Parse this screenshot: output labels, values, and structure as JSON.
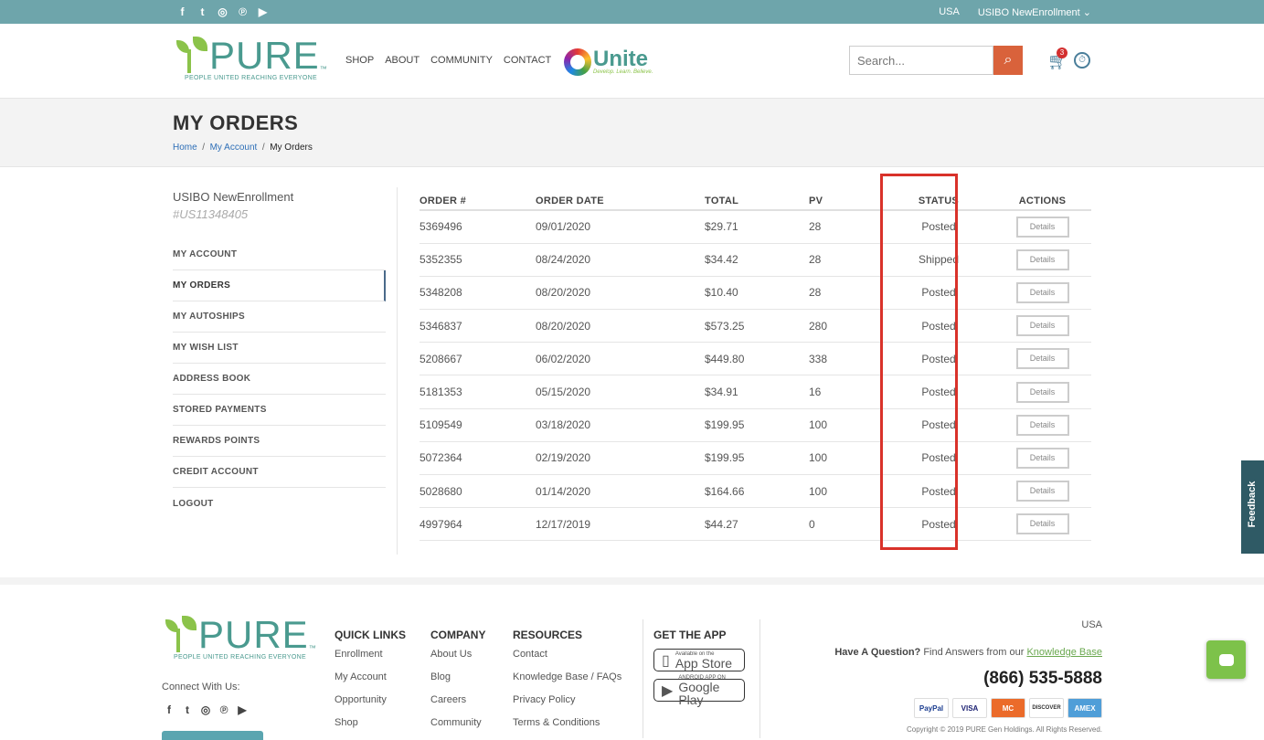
{
  "topbar": {
    "social_icons": [
      "facebook-icon",
      "twitter-icon",
      "instagram-icon",
      "pinterest-icon",
      "youtube-icon"
    ],
    "social_glyphs": [
      "f",
      "t",
      "◎",
      "℗",
      "▶"
    ],
    "country": "USA",
    "account": "USIBO NewEnrollment ⌄"
  },
  "header": {
    "logo_word": "PURE",
    "logo_tm": "™",
    "logo_tagline": "PEOPLE UNITED REACHING EVERYONE",
    "nav": [
      "SHOP",
      "ABOUT",
      "COMMUNITY",
      "CONTACT"
    ],
    "unite_word": "Unite",
    "unite_tagline": "Develop. Learn. Believe.",
    "search_placeholder": "Search...",
    "cart_count": "3"
  },
  "page": {
    "title": "MY ORDERS",
    "breadcrumb": [
      "Home",
      "My Account",
      "My Orders"
    ],
    "breadcrumb_sep": "/"
  },
  "sidebar": {
    "username": "USIBO NewEnrollment",
    "user_id": "#US11348405",
    "items": [
      "MY ACCOUNT",
      "MY ORDERS",
      "MY AUTOSHIPS",
      "MY WISH LIST",
      "ADDRESS BOOK",
      "STORED PAYMENTS",
      "REWARDS POINTS",
      "CREDIT ACCOUNT",
      "LOGOUT"
    ],
    "active_index": 1
  },
  "orders": {
    "columns": [
      "ORDER #",
      "ORDER DATE",
      "TOTAL",
      "PV",
      "STATUS",
      "ACTIONS"
    ],
    "action_label": "Details",
    "rows": [
      [
        "5369496",
        "09/01/2020",
        "$29.71",
        "28",
        "Posted"
      ],
      [
        "5352355",
        "08/24/2020",
        "$34.42",
        "28",
        "Shipped"
      ],
      [
        "5348208",
        "08/20/2020",
        "$10.40",
        "28",
        "Posted"
      ],
      [
        "5346837",
        "08/20/2020",
        "$573.25",
        "280",
        "Posted"
      ],
      [
        "5208667",
        "06/02/2020",
        "$449.80",
        "338",
        "Posted"
      ],
      [
        "5181353",
        "05/15/2020",
        "$34.91",
        "16",
        "Posted"
      ],
      [
        "5109549",
        "03/18/2020",
        "$199.95",
        "100",
        "Posted"
      ],
      [
        "5072364",
        "02/19/2020",
        "$199.95",
        "100",
        "Posted"
      ],
      [
        "5028680",
        "01/14/2020",
        "$164.66",
        "100",
        "Posted"
      ],
      [
        "4997964",
        "12/17/2019",
        "$44.27",
        "0",
        "Posted"
      ]
    ]
  },
  "feedback_label": "Feedback",
  "footer": {
    "connect_label": "Connect With Us:",
    "quick_links": {
      "title": "QUICK LINKS",
      "items": [
        "Enrollment",
        "My Account",
        "Opportunity",
        "Shop"
      ]
    },
    "company": {
      "title": "COMPANY",
      "items": [
        "About Us",
        "Blog",
        "Careers",
        "Community"
      ]
    },
    "resources": {
      "title": "RESOURCES",
      "items": [
        "Contact",
        "Knowledge Base / FAQs",
        "Privacy Policy",
        "Terms & Conditions"
      ]
    },
    "app": {
      "title": "GET THE APP",
      "appstore_small": "Available on the",
      "appstore_big": "App Store",
      "google_small": "ANDROID APP ON",
      "google_big": "Google Play"
    },
    "country": "USA",
    "question_bold": "Have A Question?",
    "question_text": " Find Answers from our ",
    "question_link": "Knowledge Base",
    "phone": "(866) 535-5888",
    "cards": [
      "PayPal",
      "VISA",
      "MC",
      "DISCOVER",
      "AMEX"
    ],
    "copyright": "Copyright © 2019 PURE Gen Holdings. All Rights Reserved."
  },
  "colors": {
    "topbar": "#6ea5ab",
    "brand": "#4a9a8f",
    "accent": "#d9623b",
    "highlight": "#d9322a",
    "link": "#2e6fb7"
  }
}
